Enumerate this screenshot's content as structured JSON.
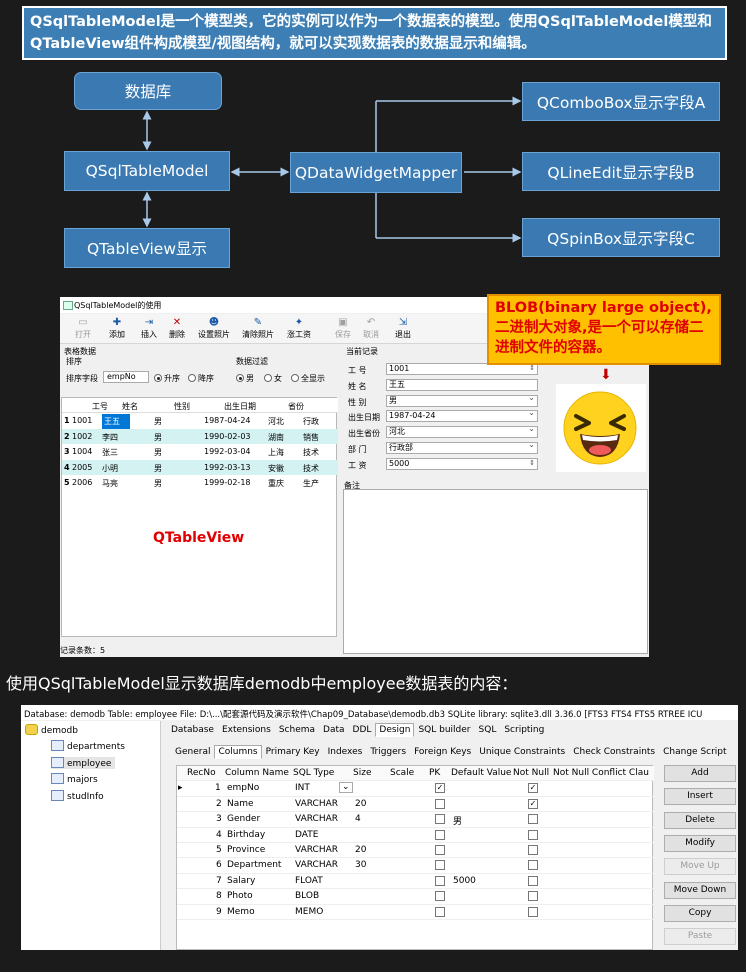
{
  "intro": "QSqlTableModel是一个模型类，它的实例可以作为一个数据表的模型。使用QSqlTableModel模型和QTableView组件构成模型/视图结构，就可以实现数据表的数据显示和编辑。",
  "diagram": {
    "database": "数据库",
    "model": "QSqlTableModel",
    "view": "QTableView显示",
    "mapper": "QDataWidgetMapper",
    "combo": "QComboBox显示字段A",
    "lineedit": "QLineEdit显示字段B",
    "spinbox": "QSpinBox显示字段C"
  },
  "demo": {
    "title": "QSqlTableModel的使用",
    "toolbar": [
      {
        "label": "打开",
        "icon": "open-folder-icon",
        "glyph": "▭",
        "enabled": false
      },
      {
        "label": "添加",
        "icon": "add-icon",
        "glyph": "✚",
        "enabled": true
      },
      {
        "label": "插入",
        "icon": "insert-icon",
        "glyph": "⇥",
        "enabled": true
      },
      {
        "label": "删除",
        "icon": "delete-icon",
        "glyph": "✕",
        "enabled": true
      },
      {
        "label": "设置照片",
        "icon": "photo-icon",
        "glyph": "☻",
        "enabled": true
      },
      {
        "label": "清除照片",
        "icon": "clear-photo-icon",
        "glyph": "✎",
        "enabled": true
      },
      {
        "label": "涨工资",
        "icon": "raise-salary-icon",
        "glyph": "✦",
        "enabled": true
      },
      {
        "label": "保存",
        "icon": "save-icon",
        "glyph": "▣",
        "enabled": false
      },
      {
        "label": "取消",
        "icon": "undo-icon",
        "glyph": "↶",
        "enabled": false
      },
      {
        "label": "退出",
        "icon": "exit-icon",
        "glyph": "⇲",
        "enabled": true
      }
    ],
    "table_group": "表格数据",
    "sort_group": "排序",
    "sort_field_label": "排序字段",
    "sort_field_value": "empNo",
    "asc": "升序",
    "desc": "降序",
    "filter_group": "数据过滤",
    "filter_male": "男",
    "filter_female": "女",
    "filter_all": "全显示",
    "columns": [
      "工号",
      "姓名",
      "性别",
      "出生日期",
      "省份",
      ""
    ],
    "rows": [
      {
        "n": "1",
        "cells": [
          "1001",
          "王五",
          "男",
          "1987-04-24",
          "河北",
          "行政"
        ]
      },
      {
        "n": "2",
        "cells": [
          "1002",
          "李四",
          "男",
          "1990-02-03",
          "湖南",
          "销售"
        ]
      },
      {
        "n": "3",
        "cells": [
          "1004",
          "张三",
          "男",
          "1992-03-04",
          "上海",
          "技术"
        ]
      },
      {
        "n": "4",
        "cells": [
          "2005",
          "小明",
          "男",
          "1992-03-13",
          "安徽",
          "技术"
        ]
      },
      {
        "n": "5",
        "cells": [
          "2006",
          "马亮",
          "男",
          "1999-02-18",
          "重庆",
          "生产"
        ]
      }
    ],
    "view_label": "QTableView",
    "status": "记录条数：5",
    "record_group": "当前记录",
    "fields": [
      {
        "label": "工  号",
        "value": "1001",
        "kind": "spin"
      },
      {
        "label": "姓  名",
        "value": "王五",
        "kind": "line"
      },
      {
        "label": "性  别",
        "value": "男",
        "kind": "combo"
      },
      {
        "label": "出生日期",
        "value": "1987-04-24",
        "kind": "combo"
      },
      {
        "label": "出生省份",
        "value": "河北",
        "kind": "combo"
      },
      {
        "label": "部  门",
        "value": "行政部",
        "kind": "combo"
      },
      {
        "label": "工  资",
        "value": "5000",
        "kind": "spin"
      }
    ],
    "memo_label": "备注"
  },
  "blob_note": "BLOB(binary large object),二进制大对象,是一个可以存储二进制文件的容器。",
  "caption": "使用QSqlTableModel显示数据库demodb中employee数据表的内容：",
  "dbb": {
    "info": "Database: demodb   Table: employee   File: D:\\...\\配套源代码及演示软件\\Chap09_Database\\demodb.db3          SQLite library: sqlite3.dll 3.36.0 [FTS3 FTS4 FTS5 RTREE ICU",
    "tree_root": "demodb",
    "tables": [
      "departments",
      "employee",
      "majors",
      "studInfo"
    ],
    "main_tabs": [
      "Database",
      "Extensions",
      "Schema",
      "Data",
      "DDL",
      "Design",
      "SQL builder",
      "SQL",
      "Scripting"
    ],
    "sub_tabs": [
      "General",
      "Columns",
      "Primary Key",
      "Indexes",
      "Triggers",
      "Foreign Keys",
      "Unique Constraints",
      "Check Constraints",
      "Change Script"
    ],
    "grid_headers": [
      "RecNo",
      "Column Name",
      "SQL Type",
      "Size",
      "Scale",
      "PK",
      "Default Value",
      "Not Null",
      "Not Null Conflict Clau"
    ],
    "grid_rows": [
      {
        "recno": "1",
        "name": "empNo",
        "type": "INT",
        "size": "",
        "pk": true,
        "def": "",
        "nn": true
      },
      {
        "recno": "2",
        "name": "Name",
        "type": "VARCHAR",
        "size": "20",
        "pk": false,
        "def": "",
        "nn": true
      },
      {
        "recno": "3",
        "name": "Gender",
        "type": "VARCHAR",
        "size": "4",
        "pk": false,
        "def": "男",
        "nn": false
      },
      {
        "recno": "4",
        "name": "Birthday",
        "type": "DATE",
        "size": "",
        "pk": false,
        "def": "",
        "nn": false
      },
      {
        "recno": "5",
        "name": "Province",
        "type": "VARCHAR",
        "size": "20",
        "pk": false,
        "def": "",
        "nn": false
      },
      {
        "recno": "6",
        "name": "Department",
        "type": "VARCHAR",
        "size": "30",
        "pk": false,
        "def": "",
        "nn": false
      },
      {
        "recno": "7",
        "name": "Salary",
        "type": "FLOAT",
        "size": "",
        "pk": false,
        "def": "5000",
        "nn": false
      },
      {
        "recno": "8",
        "name": "Photo",
        "type": "BLOB",
        "size": "",
        "pk": false,
        "def": "",
        "nn": false
      },
      {
        "recno": "9",
        "name": "Memo",
        "type": "MEMO",
        "size": "",
        "pk": false,
        "def": "",
        "nn": false
      }
    ],
    "buttons": [
      {
        "label": "Add",
        "enabled": true
      },
      {
        "label": "Insert",
        "enabled": true
      },
      {
        "label": "Delete",
        "enabled": true
      },
      {
        "label": "Modify",
        "enabled": true
      },
      {
        "label": "Move Up",
        "enabled": false
      },
      {
        "label": "Move Down",
        "enabled": true
      },
      {
        "label": "Copy",
        "enabled": true
      },
      {
        "label": "Paste",
        "enabled": false
      }
    ]
  }
}
